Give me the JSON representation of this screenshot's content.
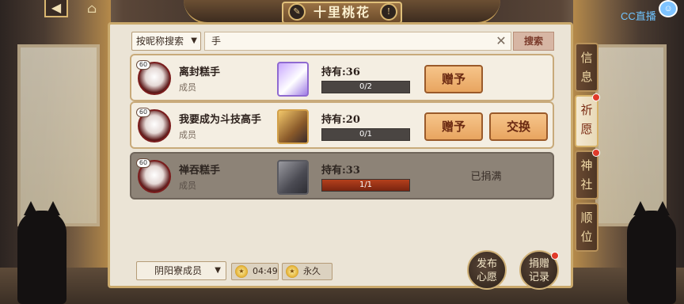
{
  "header": {
    "title": "十里桃花",
    "back_icon": "back-arrow-icon",
    "home_icon": "home-icon"
  },
  "watermark": {
    "text": "CC直播"
  },
  "search": {
    "mode_label": "按昵称搜索",
    "query": "手",
    "button_label": "搜索"
  },
  "members": [
    {
      "name": "离封糕手",
      "role": "成员",
      "level": "60",
      "owned": "持有:36",
      "progress_text": "0/2",
      "progress_fraction": 0,
      "actions": [
        "赠予"
      ]
    },
    {
      "name": "我要成为斗技高手",
      "role": "成员",
      "level": "60",
      "owned": "持有:20",
      "progress_text": "0/1",
      "progress_fraction": 0,
      "actions": [
        "赠予",
        "交换"
      ]
    },
    {
      "name": "禅吞糕手",
      "role": "成员",
      "level": "60",
      "owned": "持有:33",
      "progress_text": "1/1",
      "progress_fraction": 1,
      "status": "已捐满"
    }
  ],
  "footer": {
    "filter_label": "阴阳寮成员",
    "timer": "04:49",
    "duration": "永久",
    "publish_label": [
      "发布",
      "心愿"
    ],
    "record_label": [
      "捐赠",
      "记录"
    ]
  },
  "side_tabs": [
    {
      "label": "信息",
      "active": false,
      "badge": false
    },
    {
      "label": "祈愿",
      "active": true,
      "badge": true
    },
    {
      "label": "神社",
      "active": false,
      "badge": true
    },
    {
      "label": "顺位",
      "active": false,
      "badge": false
    }
  ],
  "colors": {
    "accent": "#c9a35a",
    "button": "#e8a560",
    "badge": "#e03a2a"
  }
}
